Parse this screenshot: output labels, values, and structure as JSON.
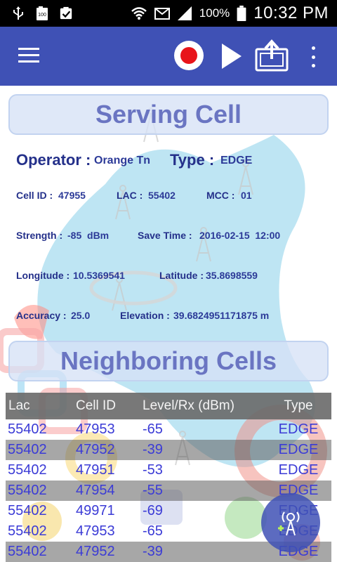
{
  "status_bar": {
    "battery_percent": "100%",
    "time": "10:32 PM",
    "icons": [
      "usb-icon",
      "battery-full-small-icon",
      "clipboard-check-icon",
      "wifi-icon",
      "email-icon",
      "signal-icon",
      "battery-icon"
    ]
  },
  "toolbar": {
    "menu_icon": "hamburger-menu-icon",
    "record_icon": "record-icon",
    "play_icon": "play-icon",
    "upload_icon": "upload-icon",
    "more_icon": "more-vert-icon"
  },
  "serving": {
    "title": "Serving Cell",
    "operator_label": "Operator :",
    "operator_value": "Orange Tn",
    "type_label": "Type :",
    "type_value": "EDGE",
    "cellid_label": "Cell ID :",
    "cellid_value": "47955",
    "lac_label": "LAC :",
    "lac_value": "55402",
    "mcc_label": "MCC :",
    "mcc_value": "01",
    "strength_label": "Strength :",
    "strength_value": "-85  dBm",
    "savetime_label": "Save Time :",
    "savetime_value": "2016-02-15  12:00",
    "longitude_label": "Longitude :",
    "longitude_value": "10.5369541",
    "latitude_label": "Latitude :",
    "latitude_value": "35.8698559",
    "accuracy_label": "Accuracy :",
    "accuracy_value": "25.0",
    "elevation_label": "Elevation :",
    "elevation_value": "39.6824951171875 m"
  },
  "neighbors": {
    "title": "Neighboring Cells",
    "columns": [
      "Lac",
      "Cell ID",
      "Level/Rx (dBm)",
      "Type"
    ],
    "rows": [
      [
        "55402",
        "47953",
        "-65",
        "EDGE"
      ],
      [
        "55402",
        "47952",
        "-39",
        "EDGE"
      ],
      [
        "55402",
        "47951",
        "-53",
        "EDGE"
      ],
      [
        "55402",
        "47954",
        "-55",
        "EDGE"
      ],
      [
        "55402",
        "49971",
        "-69",
        "EDGE"
      ],
      [
        "55402",
        "47953",
        "-65",
        "EDGE"
      ],
      [
        "55402",
        "47952",
        "-39",
        "EDGE"
      ]
    ]
  },
  "fab": {
    "icon": "antenna-add-icon"
  },
  "colors": {
    "primary": "#3f51b5",
    "record": "#e8141a",
    "label": "#24308a",
    "row_text": "#3b3bd6"
  }
}
